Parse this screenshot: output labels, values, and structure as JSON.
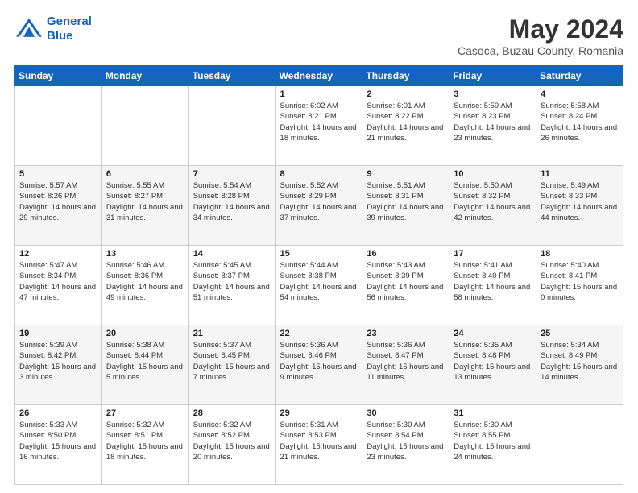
{
  "logo": {
    "line1": "General",
    "line2": "Blue"
  },
  "title": "May 2024",
  "location": "Casoca, Buzau County, Romania",
  "weekdays": [
    "Sunday",
    "Monday",
    "Tuesday",
    "Wednesday",
    "Thursday",
    "Friday",
    "Saturday"
  ],
  "weeks": [
    [
      {
        "day": "",
        "sunrise": "",
        "sunset": "",
        "daylight": ""
      },
      {
        "day": "",
        "sunrise": "",
        "sunset": "",
        "daylight": ""
      },
      {
        "day": "",
        "sunrise": "",
        "sunset": "",
        "daylight": ""
      },
      {
        "day": "1",
        "sunrise": "Sunrise: 6:02 AM",
        "sunset": "Sunset: 8:21 PM",
        "daylight": "Daylight: 14 hours and 18 minutes."
      },
      {
        "day": "2",
        "sunrise": "Sunrise: 6:01 AM",
        "sunset": "Sunset: 8:22 PM",
        "daylight": "Daylight: 14 hours and 21 minutes."
      },
      {
        "day": "3",
        "sunrise": "Sunrise: 5:59 AM",
        "sunset": "Sunset: 8:23 PM",
        "daylight": "Daylight: 14 hours and 23 minutes."
      },
      {
        "day": "4",
        "sunrise": "Sunrise: 5:58 AM",
        "sunset": "Sunset: 8:24 PM",
        "daylight": "Daylight: 14 hours and 26 minutes."
      }
    ],
    [
      {
        "day": "5",
        "sunrise": "Sunrise: 5:57 AM",
        "sunset": "Sunset: 8:26 PM",
        "daylight": "Daylight: 14 hours and 29 minutes."
      },
      {
        "day": "6",
        "sunrise": "Sunrise: 5:55 AM",
        "sunset": "Sunset: 8:27 PM",
        "daylight": "Daylight: 14 hours and 31 minutes."
      },
      {
        "day": "7",
        "sunrise": "Sunrise: 5:54 AM",
        "sunset": "Sunset: 8:28 PM",
        "daylight": "Daylight: 14 hours and 34 minutes."
      },
      {
        "day": "8",
        "sunrise": "Sunrise: 5:52 AM",
        "sunset": "Sunset: 8:29 PM",
        "daylight": "Daylight: 14 hours and 37 minutes."
      },
      {
        "day": "9",
        "sunrise": "Sunrise: 5:51 AM",
        "sunset": "Sunset: 8:31 PM",
        "daylight": "Daylight: 14 hours and 39 minutes."
      },
      {
        "day": "10",
        "sunrise": "Sunrise: 5:50 AM",
        "sunset": "Sunset: 8:32 PM",
        "daylight": "Daylight: 14 hours and 42 minutes."
      },
      {
        "day": "11",
        "sunrise": "Sunrise: 5:49 AM",
        "sunset": "Sunset: 8:33 PM",
        "daylight": "Daylight: 14 hours and 44 minutes."
      }
    ],
    [
      {
        "day": "12",
        "sunrise": "Sunrise: 5:47 AM",
        "sunset": "Sunset: 8:34 PM",
        "daylight": "Daylight: 14 hours and 47 minutes."
      },
      {
        "day": "13",
        "sunrise": "Sunrise: 5:46 AM",
        "sunset": "Sunset: 8:36 PM",
        "daylight": "Daylight: 14 hours and 49 minutes."
      },
      {
        "day": "14",
        "sunrise": "Sunrise: 5:45 AM",
        "sunset": "Sunset: 8:37 PM",
        "daylight": "Daylight: 14 hours and 51 minutes."
      },
      {
        "day": "15",
        "sunrise": "Sunrise: 5:44 AM",
        "sunset": "Sunset: 8:38 PM",
        "daylight": "Daylight: 14 hours and 54 minutes."
      },
      {
        "day": "16",
        "sunrise": "Sunrise: 5:43 AM",
        "sunset": "Sunset: 8:39 PM",
        "daylight": "Daylight: 14 hours and 56 minutes."
      },
      {
        "day": "17",
        "sunrise": "Sunrise: 5:41 AM",
        "sunset": "Sunset: 8:40 PM",
        "daylight": "Daylight: 14 hours and 58 minutes."
      },
      {
        "day": "18",
        "sunrise": "Sunrise: 5:40 AM",
        "sunset": "Sunset: 8:41 PM",
        "daylight": "Daylight: 15 hours and 0 minutes."
      }
    ],
    [
      {
        "day": "19",
        "sunrise": "Sunrise: 5:39 AM",
        "sunset": "Sunset: 8:42 PM",
        "daylight": "Daylight: 15 hours and 3 minutes."
      },
      {
        "day": "20",
        "sunrise": "Sunrise: 5:38 AM",
        "sunset": "Sunset: 8:44 PM",
        "daylight": "Daylight: 15 hours and 5 minutes."
      },
      {
        "day": "21",
        "sunrise": "Sunrise: 5:37 AM",
        "sunset": "Sunset: 8:45 PM",
        "daylight": "Daylight: 15 hours and 7 minutes."
      },
      {
        "day": "22",
        "sunrise": "Sunrise: 5:36 AM",
        "sunset": "Sunset: 8:46 PM",
        "daylight": "Daylight: 15 hours and 9 minutes."
      },
      {
        "day": "23",
        "sunrise": "Sunrise: 5:36 AM",
        "sunset": "Sunset: 8:47 PM",
        "daylight": "Daylight: 15 hours and 11 minutes."
      },
      {
        "day": "24",
        "sunrise": "Sunrise: 5:35 AM",
        "sunset": "Sunset: 8:48 PM",
        "daylight": "Daylight: 15 hours and 13 minutes."
      },
      {
        "day": "25",
        "sunrise": "Sunrise: 5:34 AM",
        "sunset": "Sunset: 8:49 PM",
        "daylight": "Daylight: 15 hours and 14 minutes."
      }
    ],
    [
      {
        "day": "26",
        "sunrise": "Sunrise: 5:33 AM",
        "sunset": "Sunset: 8:50 PM",
        "daylight": "Daylight: 15 hours and 16 minutes."
      },
      {
        "day": "27",
        "sunrise": "Sunrise: 5:32 AM",
        "sunset": "Sunset: 8:51 PM",
        "daylight": "Daylight: 15 hours and 18 minutes."
      },
      {
        "day": "28",
        "sunrise": "Sunrise: 5:32 AM",
        "sunset": "Sunset: 8:52 PM",
        "daylight": "Daylight: 15 hours and 20 minutes."
      },
      {
        "day": "29",
        "sunrise": "Sunrise: 5:31 AM",
        "sunset": "Sunset: 8:53 PM",
        "daylight": "Daylight: 15 hours and 21 minutes."
      },
      {
        "day": "30",
        "sunrise": "Sunrise: 5:30 AM",
        "sunset": "Sunset: 8:54 PM",
        "daylight": "Daylight: 15 hours and 23 minutes."
      },
      {
        "day": "31",
        "sunrise": "Sunrise: 5:30 AM",
        "sunset": "Sunset: 8:55 PM",
        "daylight": "Daylight: 15 hours and 24 minutes."
      },
      {
        "day": "",
        "sunrise": "",
        "sunset": "",
        "daylight": ""
      }
    ]
  ]
}
